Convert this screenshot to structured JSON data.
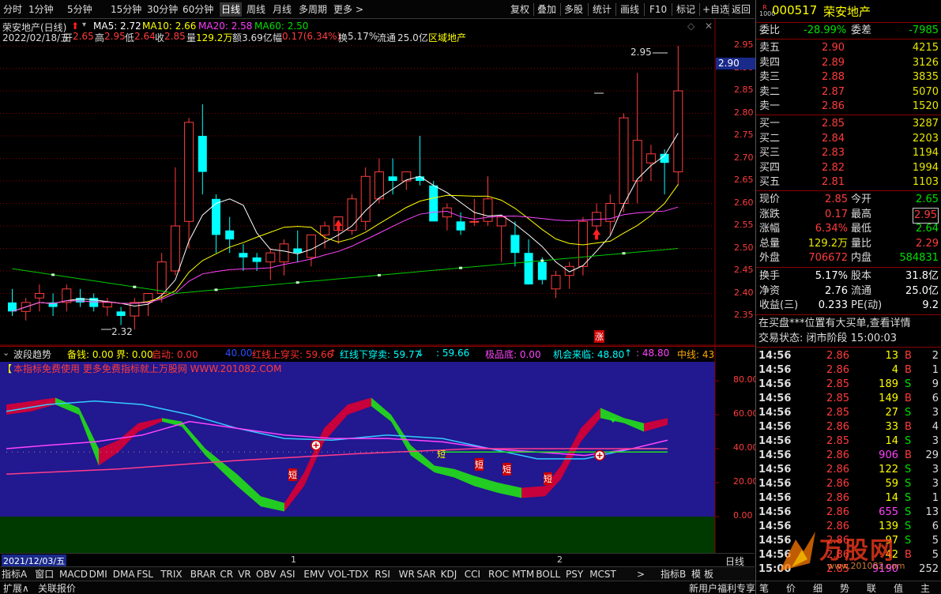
{
  "toolbar": {
    "periods": [
      "分时",
      "1分钟",
      "5分钟",
      "15分钟",
      "30分钟",
      "60分钟",
      "日线",
      "周线",
      "月线",
      "多周期",
      "更多"
    ],
    "more_arrow": ">",
    "right": [
      "复权",
      "叠加",
      "多股",
      "统计",
      "画线",
      "F10",
      "标记",
      "+自选",
      "返回"
    ]
  },
  "chart_header": {
    "name": "荣安地产(日线)",
    "ma5": "MA5: 2.72",
    "ma10": "MA10: 2.66",
    "ma20": "MA20: 2.58",
    "ma60": "MA60: 2.50",
    "date": "2022/02/18/五",
    "open_l": "开",
    "open": "2.65",
    "high_l": "高",
    "high": "2.95",
    "low_l": "低",
    "low": "2.64",
    "close_l": "收",
    "close": "2.85",
    "vol_l": "量",
    "vol": "129.2万",
    "amt_l": "额",
    "amt": "3.69亿",
    "chg_l": "幅",
    "chg": "0.17(6.34%)",
    "turnover_l": "换",
    "turnover": "5.17%",
    "float_l": "流通",
    "float": "25.0亿",
    "region": "区域地产"
  },
  "main_axis": {
    "labels": [
      "2.95",
      "2.90",
      "2.85",
      "2.80",
      "2.75",
      "2.70",
      "2.65",
      "2.60",
      "2.55",
      "2.50",
      "2.45",
      "2.40",
      "2.35"
    ],
    "current": "2.90"
  },
  "annotations": {
    "high_mark": "2.95",
    "low_mark": "2.32",
    "zhang": "涨"
  },
  "indicator": {
    "name": "波段趋势",
    "beiqian": "备钱: 0.00",
    "jie": "界: 0.00",
    "qidong": "启动: 0.00",
    "v40": "40.00",
    "hongxian_up": "红线上穿买: 59.66",
    "hongxian_up_arrow": "↑",
    "hongxian_down": "红线下穿卖: 59.77",
    "hongxian_down_arrow": "↓",
    "v5966": ": 59.66",
    "jipindi": "极品底: 0.00",
    "jihui": "机会来临: 48.80",
    "jihui_arrow": "↑",
    "v4880": ": 48.80",
    "zhongxian": "中线: 43",
    "ad_text": "本指标免费使用 更多免费指标就上万股网 WWW.201082.COM",
    "axis": [
      "80.00",
      "60.00",
      "40.00",
      "20.00",
      "0.00"
    ],
    "short_labels": [
      "短",
      "短",
      "短",
      "短",
      "短"
    ]
  },
  "datebar": {
    "date": "2021/12/03/五",
    "m1": "1",
    "m2": "2",
    "period": "日线"
  },
  "bottom_tabs": [
    "指标A",
    "窗口",
    "MACD",
    "DMI",
    "DMA",
    "FSL",
    "TRIX",
    "BRAR",
    "CR",
    "VR",
    "OBV",
    "ASI",
    "EMV",
    "VOL-TDX",
    "RSI",
    "WR",
    "SAR",
    "KDJ",
    "CCI",
    "ROC",
    "MTM",
    "BOLL",
    "PSY",
    "MCST"
  ],
  "bottom_right": {
    "arrow": ">",
    "indB": "指标B",
    "mo": "模",
    "ban": "板"
  },
  "status": {
    "expand": "扩展∧",
    "related": "关联报价",
    "promo": "新用户福利专享"
  },
  "right_tabs": [
    "笔",
    "价",
    "细",
    "势",
    "联",
    "值",
    "主"
  ],
  "stock": {
    "r_label": "R",
    "code": "000517",
    "name": "荣安地产",
    "mark": "1000"
  },
  "weibi": {
    "label": "委比",
    "value": "-28.99%",
    "label2": "委差",
    "value2": "-7985"
  },
  "asks": [
    {
      "label": "卖五",
      "price": "2.90",
      "vol": "4215"
    },
    {
      "label": "卖四",
      "price": "2.89",
      "vol": "3126"
    },
    {
      "label": "卖三",
      "price": "2.88",
      "vol": "3835"
    },
    {
      "label": "卖二",
      "price": "2.87",
      "vol": "5070"
    },
    {
      "label": "卖一",
      "price": "2.86",
      "vol": "1520"
    }
  ],
  "bids": [
    {
      "label": "买一",
      "price": "2.85",
      "vol": "3287"
    },
    {
      "label": "买二",
      "price": "2.84",
      "vol": "2203"
    },
    {
      "label": "买三",
      "price": "2.83",
      "vol": "1194"
    },
    {
      "label": "买四",
      "price": "2.82",
      "vol": "1994"
    },
    {
      "label": "买五",
      "price": "2.81",
      "vol": "1103"
    }
  ],
  "quote": [
    {
      "l1": "现价",
      "v1": "2.85",
      "l2": "今开",
      "v2": "2.65"
    },
    {
      "l1": "涨跌",
      "v1": "0.17",
      "l2": "最高",
      "v2": "2.95"
    },
    {
      "l1": "涨幅",
      "v1": "6.34%",
      "l2": "最低",
      "v2": "2.64"
    },
    {
      "l1": "总量",
      "v1": "129.2万",
      "l2": "量比",
      "v2": "2.29"
    },
    {
      "l1": "外盘",
      "v1": "706672",
      "l2": "内盘",
      "v2": "584831"
    }
  ],
  "quote2": [
    {
      "l1": "换手",
      "v1": "5.17%",
      "l2": "股本",
      "v2": "31.8亿"
    },
    {
      "l1": "净资",
      "v1": "2.76",
      "l2": "流通",
      "v2": "25.0亿"
    },
    {
      "l1": "收益(三)",
      "v1": "0.233",
      "l2": "PE(动)",
      "v2": "9.2"
    }
  ],
  "notice": "在买盘***位置有大买单,查看详情",
  "trade_status": "交易状态: 闭市阶段 15:00:03",
  "ticks": [
    {
      "t": "14:56",
      "p": "2.86",
      "v": "13",
      "s": "B",
      "n": "2"
    },
    {
      "t": "14:56",
      "p": "2.86",
      "v": "4",
      "s": "B",
      "n": "1"
    },
    {
      "t": "14:56",
      "p": "2.85",
      "v": "189",
      "s": "S",
      "n": "9"
    },
    {
      "t": "14:56",
      "p": "2.85",
      "v": "149",
      "s": "B",
      "n": "6"
    },
    {
      "t": "14:56",
      "p": "2.85",
      "v": "27",
      "s": "S",
      "n": "3"
    },
    {
      "t": "14:56",
      "p": "2.86",
      "v": "33",
      "s": "B",
      "n": "4"
    },
    {
      "t": "14:56",
      "p": "2.85",
      "v": "14",
      "s": "S",
      "n": "3"
    },
    {
      "t": "14:56",
      "p": "2.86",
      "v": "906",
      "s": "B",
      "n": "29"
    },
    {
      "t": "14:56",
      "p": "2.86",
      "v": "122",
      "s": "S",
      "n": "3"
    },
    {
      "t": "14:56",
      "p": "2.86",
      "v": "59",
      "s": "S",
      "n": "3"
    },
    {
      "t": "14:56",
      "p": "2.86",
      "v": "14",
      "s": "S",
      "n": "1"
    },
    {
      "t": "14:56",
      "p": "2.86",
      "v": "655",
      "s": "S",
      "n": "13"
    },
    {
      "t": "14:56",
      "p": "2.86",
      "v": "139",
      "s": "S",
      "n": "6"
    },
    {
      "t": "14:56",
      "p": "2.86",
      "v": "97",
      "s": "S",
      "n": "5"
    },
    {
      "t": "14:56",
      "p": "2.86",
      "v": "42",
      "s": "B",
      "n": "5"
    },
    {
      "t": "15:00",
      "p": "2.85",
      "v": "9190",
      "s": "",
      "n": "252"
    }
  ],
  "watermark": {
    "text": "万股网",
    "url": "www.201082.com"
  },
  "colors": {
    "up": "#ff3c3c",
    "down": "#00ffff",
    "ma5": "#ffffff",
    "ma10": "#ffff00",
    "ma20": "#ff00ff",
    "ma60": "#00cc00",
    "sub_bg": "#22188f",
    "sub_floor": "#003a00"
  }
}
